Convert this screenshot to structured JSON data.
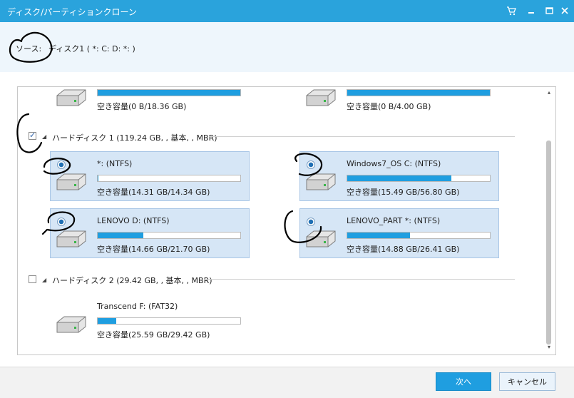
{
  "window": {
    "title": "ディスク/パーティションクローン",
    "controls": [
      "cart-icon",
      "minimize-icon",
      "maximize-icon",
      "close-icon"
    ]
  },
  "source": {
    "label": "ソース:",
    "value": "ディスク1 ( *: C: D: *: )"
  },
  "top_row": [
    {
      "free": "空き容量(0 B/18.36 GB)",
      "used_fraction": 1.0
    },
    {
      "free": "空き容量(0 B/4.00 GB)",
      "used_fraction": 1.0
    }
  ],
  "disk1": {
    "header": "ハードディスク 1 (119.24 GB, , 基本, , MBR)",
    "checked": true,
    "partitions": [
      {
        "name": "*: (NTFS)",
        "free": "空き容量(14.31 GB/14.34 GB)",
        "used_fraction": 0.002
      },
      {
        "name": "Windows7_OS C: (NTFS)",
        "free": "空き容量(15.49 GB/56.80 GB)",
        "used_fraction": 0.73
      },
      {
        "name": "LENOVO D: (NTFS)",
        "free": "空き容量(14.66 GB/21.70 GB)",
        "used_fraction": 0.32
      },
      {
        "name": "LENOVO_PART *: (NTFS)",
        "free": "空き容量(14.88 GB/26.41 GB)",
        "used_fraction": 0.44
      }
    ]
  },
  "disk2": {
    "header": "ハードディスク 2 (29.42 GB, , 基本, , MBR)",
    "checked": false,
    "partitions": [
      {
        "name": "Transcend F: (FAT32)",
        "free": "空き容量(25.59 GB/29.42 GB)",
        "used_fraction": 0.13
      }
    ]
  },
  "buttons": {
    "next": "次へ",
    "cancel": "キャンセル"
  },
  "colors": {
    "title_bar": "#2aa3dc",
    "accent": "#1f9ee0",
    "partition_bg": "#d6e6f6"
  }
}
